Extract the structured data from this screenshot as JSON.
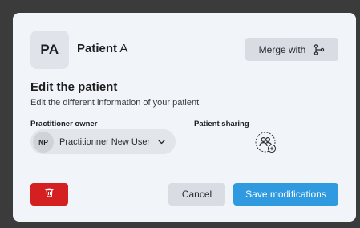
{
  "patient": {
    "initials": "PA",
    "name_bold": "Patient",
    "name_rest": "A"
  },
  "header": {
    "merge_label": "Merge with",
    "merge_icon": "merge-branch-icon"
  },
  "section": {
    "title": "Edit the patient",
    "subtitle": "Edit the different information of your patient"
  },
  "practitioner_owner": {
    "label": "Practitioner owner",
    "initials": "NP",
    "selected": "Practitionner New User",
    "icon": "chevron-down-icon"
  },
  "patient_sharing": {
    "label": "Patient sharing",
    "icon": "add-users-icon"
  },
  "footer": {
    "delete_icon": "trash-icon",
    "cancel_label": "Cancel",
    "save_label": "Save modifications"
  },
  "colors": {
    "modal_bg": "#f1f4f8",
    "backdrop": "#3b3b3b",
    "primary": "#2f9ae0",
    "danger": "#d42020",
    "secondary_btn": "#d9dde3"
  }
}
